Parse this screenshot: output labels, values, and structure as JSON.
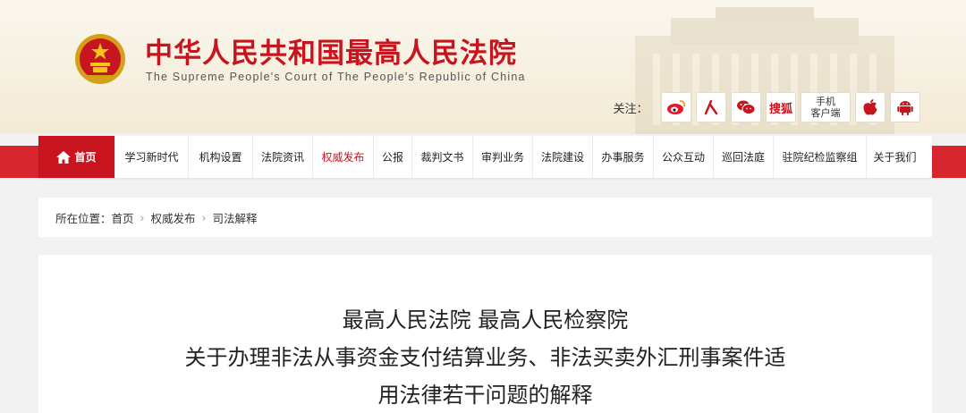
{
  "header": {
    "site_title": "中华人民共和国最高人民法院",
    "site_subtitle": "The Supreme People's Court of The People's Republic of China",
    "follow_label": "关注：",
    "social": [
      {
        "name": "weibo-icon"
      },
      {
        "name": "renmin-icon"
      },
      {
        "name": "wechat-icon"
      },
      {
        "name": "sohu-icon",
        "label": "搜狐"
      },
      {
        "name": "mobile-client",
        "label_line1": "手机",
        "label_line2": "客户端"
      },
      {
        "name": "apple-icon"
      },
      {
        "name": "android-icon"
      }
    ],
    "accent_color": "#c8141e"
  },
  "nav": {
    "home": "首页",
    "items": [
      "学习新时代",
      "机构设置",
      "法院资讯",
      "权威发布",
      "公报",
      "裁判文书",
      "审判业务",
      "法院建设",
      "办事服务",
      "公众互动",
      "巡回法庭",
      "驻院纪检监察组",
      "关于我们"
    ],
    "active": "权威发布"
  },
  "breadcrumb": {
    "prefix": "所在位置：",
    "items": [
      "首页",
      "权威发布",
      "司法解释"
    ]
  },
  "article": {
    "title_line1": "最高人民法院 最高人民检察院",
    "title_line2": "关于办理非法从事资金支付结算业务、非法买卖外汇刑事案件适",
    "title_line3": "用法律若干问题的解释"
  }
}
